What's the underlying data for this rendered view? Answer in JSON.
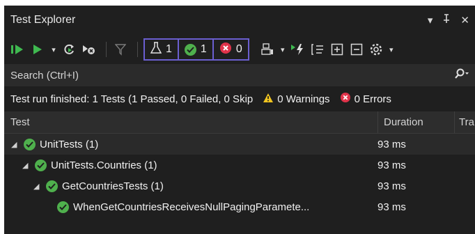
{
  "window": {
    "title": "Test Explorer",
    "pin_glyph": "▾  ⊥",
    "close_glyph": "✕"
  },
  "toolbar": {
    "filters": [
      {
        "icon": "flask-icon",
        "count": "1"
      },
      {
        "icon": "passed-icon",
        "count": "1"
      },
      {
        "icon": "failed-icon",
        "count": "0"
      }
    ]
  },
  "search": {
    "placeholder": "Search (Ctrl+I)"
  },
  "summary": {
    "text": "Test run finished: 1 Tests (1 Passed, 0 Failed, 0 Skip",
    "warnings": "0 Warnings",
    "errors": "0 Errors"
  },
  "columns": {
    "test": "Test",
    "duration": "Duration",
    "traits": "Trait"
  },
  "tree": [
    {
      "name": "UnitTests (1)",
      "duration": "93 ms",
      "level": 0,
      "expandable": true
    },
    {
      "name": "UnitTests.Countries (1)",
      "duration": "93 ms",
      "level": 1,
      "expandable": true
    },
    {
      "name": "GetCountriesTests (1)",
      "duration": "93 ms",
      "level": 2,
      "expandable": true
    },
    {
      "name": "WhenGetCountriesReceivesNullPagingParamete...",
      "duration": "93 ms",
      "level": 3,
      "expandable": false
    }
  ],
  "colors": {
    "background": "#1f1f1f",
    "accent_border": "#6b5fd1",
    "passed": "#4fb04d",
    "failed": "#e0334a",
    "warning": "#f0c420",
    "run_green": "#3fb950"
  }
}
